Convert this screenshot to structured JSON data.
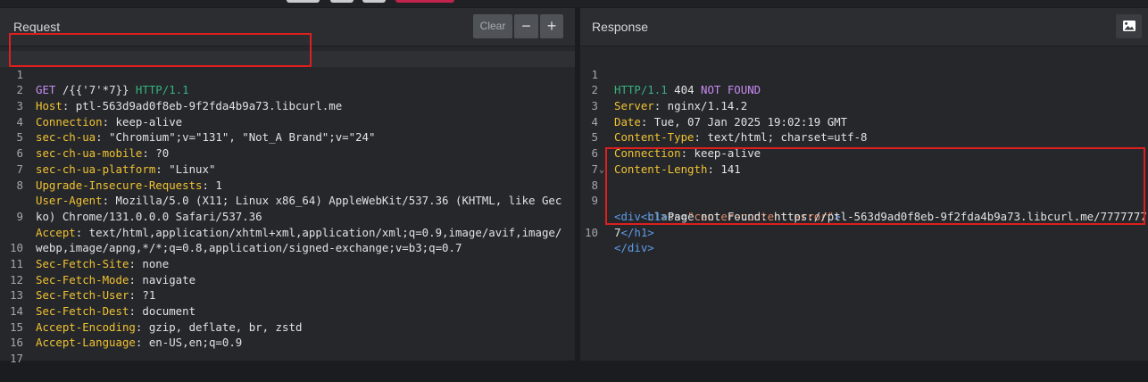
{
  "colors": {
    "background": "#1a1c20",
    "panel": "#25272b",
    "header_key": "#f1c232",
    "method": "#c98cf1",
    "protocol": "#36b37e",
    "tag": "#5e9ce8",
    "attr_value": "#e08b66",
    "highlight_box": "#dd1f1f"
  },
  "request": {
    "title": "Request",
    "clear_label": "Clear",
    "minus_label": "−",
    "plus_label": "+",
    "line_numbers": [
      "1",
      "2",
      "3",
      "4",
      "5",
      "6",
      "7",
      "8",
      "",
      "9",
      "",
      "10",
      "11",
      "12",
      "13",
      "14",
      "15",
      "16",
      "17"
    ],
    "lines": {
      "l1": {
        "method": "GET",
        "path": " /{{'7'*7}} ",
        "protocol": "HTTP/1.1"
      },
      "l2": {
        "key": "Host",
        "value": ": ptl-563d9ad0f8eb-9f2fda4b9a73.libcurl.me"
      },
      "l3": {
        "key": "Connection",
        "value": ": keep-alive"
      },
      "l4": {
        "key": "sec-ch-ua",
        "value": ": \"Chromium\";v=\"131\", \"Not_A Brand\";v=\"24\""
      },
      "l5": {
        "key": "sec-ch-ua-mobile",
        "value": ": ?0"
      },
      "l6": {
        "key": "sec-ch-ua-platform",
        "value": ": \"Linux\""
      },
      "l7": {
        "key": "Upgrade-Insecure-Requests",
        "value": ": 1"
      },
      "l8": {
        "key": "User-Agent",
        "value": ": Mozilla/5.0 (X11; Linux x86_64) AppleWebKit/537.36 (KHTML, like Gec",
        "cont": "ko) Chrome/131.0.0.0 Safari/537.36"
      },
      "l9": {
        "key": "Accept",
        "value": ": text/html,application/xhtml+xml,application/xml;q=0.9,image/avif,image/",
        "cont": "webp,image/apng,*/*;q=0.8,application/signed-exchange;v=b3;q=0.7"
      },
      "l10": {
        "key": "Sec-Fetch-Site",
        "value": ": none"
      },
      "l11": {
        "key": "Sec-Fetch-Mode",
        "value": ": navigate"
      },
      "l12": {
        "key": "Sec-Fetch-User",
        "value": ": ?1"
      },
      "l13": {
        "key": "Sec-Fetch-Dest",
        "value": ": document"
      },
      "l14": {
        "key": "Accept-Encoding",
        "value": ": gzip, deflate, br, zstd"
      },
      "l15": {
        "key": "Accept-Language",
        "value": ": en-US,en;q=0.9"
      }
    }
  },
  "response": {
    "title": "Response",
    "image_icon": "image-icon",
    "line_numbers": [
      "1",
      "2",
      "3",
      "4",
      "5",
      "6",
      "7",
      "8",
      "9",
      "",
      "10"
    ],
    "fold_glyph": "⌄",
    "status": {
      "protocol": "HTTP/1.1",
      "code": " 404 ",
      "text": "NOT FOUND"
    },
    "headers": {
      "server": {
        "key": "Server",
        "value": ": nginx/1.14.2"
      },
      "date": {
        "key": "Date",
        "value": ": Tue, 07 Jan 2025 19:02:19 GMT"
      },
      "ctype": {
        "key": "Content-Type",
        "value": ": text/html; charset=utf-8"
      },
      "conn": {
        "key": "Connection",
        "value": ": keep-alive"
      },
      "clen": {
        "key": "Content-Length",
        "value": ": 141"
      }
    },
    "body": {
      "div_open": "<div",
      "div_attr": " class=",
      "div_attr_value": "\"center-content error\"",
      "div_open_end": ">",
      "h1_indent": "    ",
      "h1_open": "<h1>",
      "h1_text": "Page not Found: https://ptl-563d9ad0f8eb-9f2fda4b9a73.libcurl.me/7777777",
      "h1_cont": "7",
      "h1_close": "</h1>",
      "div_close": "</div>"
    }
  }
}
